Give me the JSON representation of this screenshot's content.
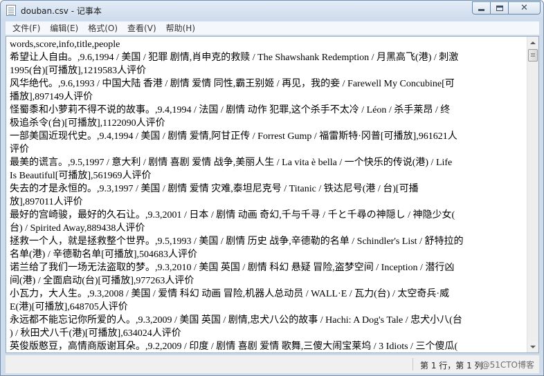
{
  "window": {
    "title": "douban.csv - 记事本"
  },
  "menu": {
    "items": [
      "文件(F)",
      "编辑(E)",
      "格式(O)",
      "查看(V)",
      "帮助(H)"
    ]
  },
  "editor": {
    "lines": [
      "words,score,info,title,people",
      "希望让人自由。,9.6,1994 / 美国 / 犯罪 剧情,肖申克的救赎 / The Shawshank Redemption / 月黑高飞(港)  /  刺激",
      "1995(台)[可播放],1219583人评价",
      "风华绝代。,9.6,1993 / 中国大陆 香港 / 剧情 爱情 同性,霸王别姬 / 再见，我的妾  /  Farewell My Concubine[可",
      "播放],897149人评价",
      "怪蜀黍和小萝莉不得不说的故事。,9.4,1994 / 法国 / 剧情 动作 犯罪,这个杀手不太冷 / Léon / 杀手莱昂  /  终",
      "极追杀令(台)[可播放],1122090人评价",
      "一部美国近现代史。,9.4,1994 / 美国 / 剧情 爱情,阿甘正传 / Forrest Gump / 福雷斯特·冈普[可播放],961621人",
      "评价",
      "最美的谎言。,9.5,1997 / 意大利 / 剧情 喜剧 爱情 战争,美丽人生 / La vita è bella / 一个快乐的传说(港)  /  Life",
      "Is Beautiful[可播放],561969人评价",
      "失去的才是永恒的。,9.3,1997 / 美国 / 剧情 爱情 灾难,泰坦尼克号 / Titanic / 铁达尼号(港 / 台)[可播",
      "放],897011人评价",
      "最好的宫崎骏，最好的久石让。,9.3,2001 / 日本 / 剧情 动画 奇幻,千与千寻 / 千と千尋の神隠し / 神隐少女(",
      "台)  /  Spirited Away,889438人评价",
      "拯救一个人，就是拯救整个世界。,9.5,1993 / 美国 / 剧情 历史 战争,辛德勒的名单 / Schindler's List / 舒特拉的",
      "名单(港)  /  辛德勒名单[可播放],504683人评价",
      "诺兰给了我们一场无法盗取的梦。,9.3,2010 / 美国 英国 / 剧情 科幻 悬疑 冒险,盗梦空间 / Inception / 潜行凶",
      "间(港)  /  全面启动(台)[可播放],977263人评价",
      "小瓦力，大人生。,9.3,2008 / 美国 / 爱情 科幻 动画 冒险,机器人总动员 / WALL·E / 瓦力(台)  /  太空奇兵·威",
      "E(港)[可播放],648705人评价",
      "永远都不能忘记你所爱的人。,9.3,2009 / 美国 英国 / 剧情,忠犬八公的故事 / Hachi: A Dog's Tale / 忠犬小八(台",
      ")  /  秋田犬八千(港)[可播放],634024人评价",
      "英俊版憨豆，高情商版谢耳朵。,9.2,2009 / 印度 / 剧情 喜剧 爱情 歌舞,三傻大闹宝莱坞 / 3 Idiots / 三个傻瓜("
    ]
  },
  "status": {
    "position": "第 1 行，第 1 列",
    "watermark": "@51CTO博客"
  }
}
